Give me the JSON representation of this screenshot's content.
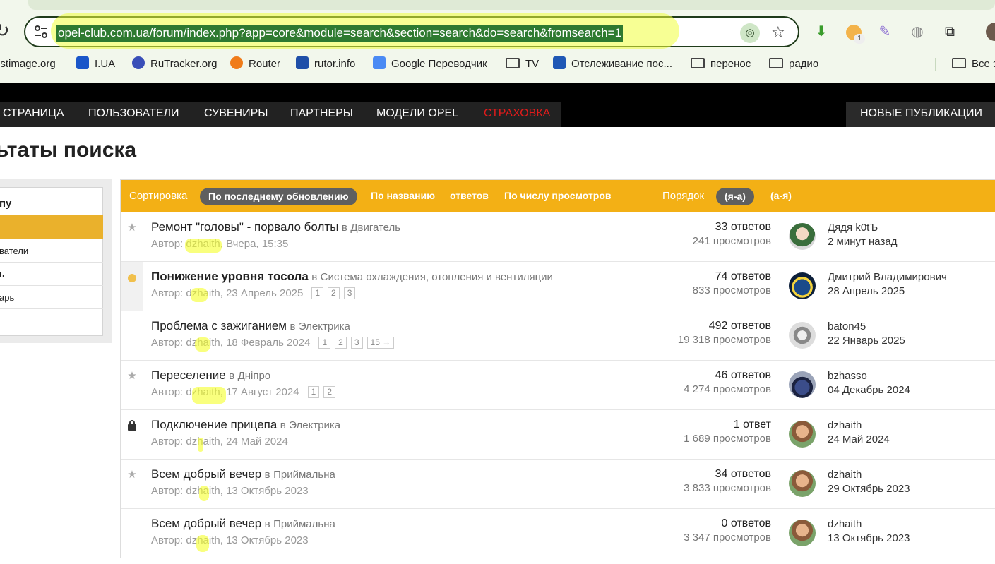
{
  "browser": {
    "url": "opel-club.com.ua/forum/index.php?app=core&module=search&section=search&do=search&fromsearch=1",
    "ext_badge": "1",
    "bookmarks": [
      {
        "label": "ostimage.org",
        "icon": "bookmark-favicon",
        "color": "#2b2b2b"
      },
      {
        "label": "I.UA",
        "icon": "iua-icon",
        "color": "#1a56c9"
      },
      {
        "label": "RuTracker.org",
        "icon": "rutracker-icon",
        "color": "#3a4fb8"
      },
      {
        "label": "Router",
        "icon": "router-icon",
        "color": "#f07c1a"
      },
      {
        "label": "rutor.info",
        "icon": "rutor-icon",
        "color": "#1f4fa8"
      },
      {
        "label": "Google Переводчик",
        "icon": "google-translate-icon",
        "color": "#4a8af4"
      },
      {
        "label": "TV",
        "icon": "folder-icon"
      },
      {
        "label": "Отслеживание пос...",
        "icon": "tracking-24-icon",
        "color": "#1f57b5"
      },
      {
        "label": "перенос",
        "icon": "folder-icon"
      },
      {
        "label": "радио",
        "icon": "folder-icon"
      },
      {
        "label": "Все з",
        "icon": "folder-icon"
      }
    ]
  },
  "nav": {
    "items": [
      "СТРАНИЦА",
      "ПОЛЬЗОВАТЕЛИ",
      "СУВЕНИРЫ",
      "ПАРТНЕРЫ",
      "МОДЕЛИ OPEL",
      "СТРАХОВКА"
    ],
    "right": "НОВЫЕ ПУБЛИКАЦИИ",
    "accent_red": "#e01b1b"
  },
  "page": {
    "title": "ьтаты поиска"
  },
  "sidebar": {
    "heading": "пу",
    "items": [
      "ватели",
      "ь",
      "арь"
    ]
  },
  "sortbar": {
    "sort_label": "Сортировка",
    "active": "По последнему обновлению",
    "by_title": "По названию",
    "by_replies": "ответов",
    "by_views": "По числу просмотров",
    "order_label": "Порядок",
    "order_active": "(я-а)",
    "order_other": "(а-я)",
    "accent": "#f3b015"
  },
  "results": [
    {
      "icon": "star-icon",
      "title": "Ремонт \"головы\" - порвало болты",
      "bold": false,
      "in": "в",
      "forum": "Двигатель",
      "author_prefix": "Автор: ",
      "author": "dzhaith",
      "date": ", Вчера, 15:35",
      "pages": [],
      "replies": "33 ответов",
      "views": "241 просмотров",
      "last_user": "Дядя k0tЪ",
      "last_date": "2 минут назад",
      "unread": false
    },
    {
      "icon": "unread-dot-icon",
      "title": "Понижение уровня тосола",
      "bold": true,
      "in": "в",
      "forum": "Система охлаждения, отопления и вентиляции",
      "author_prefix": "Автор: ",
      "author": "dzhaith",
      "date": ", 23 Апрель 2025",
      "pages": [
        "1",
        "2",
        "3"
      ],
      "replies": "74 ответов",
      "views": "833 просмотров",
      "last_user": "Дмитрий Владимирович",
      "last_date": "28 Апрель 2025",
      "unread": true
    },
    {
      "icon": "none",
      "title": "Проблема с зажиганием",
      "bold": false,
      "in": "в",
      "forum": "Электрика",
      "author_prefix": "Автор: ",
      "author": "dzhaith",
      "date": ", 18 Февраль 2024",
      "pages": [
        "1",
        "2",
        "3",
        "15 →"
      ],
      "replies": "492 ответов",
      "views": "19 318 просмотров",
      "last_user": "baton45",
      "last_date": "22 Январь 2025",
      "unread": false
    },
    {
      "icon": "star-icon",
      "title": "Переселение",
      "bold": false,
      "in": "в",
      "forum": "Дніпро",
      "author_prefix": "Автор: ",
      "author": "dzhaith",
      "date": ", 17 Август 2024",
      "pages": [
        "1",
        "2"
      ],
      "replies": "46 ответов",
      "views": "4 274 просмотров",
      "last_user": "bzhasso",
      "last_date": "04 Декабрь 2024",
      "unread": false
    },
    {
      "icon": "lock-icon",
      "title": "Подключение прицепа",
      "bold": false,
      "in": "в",
      "forum": "Электрика",
      "author_prefix": "Автор: ",
      "author": "dzhaith",
      "date": ", 24 Май 2024",
      "pages": [],
      "replies": "1 ответ",
      "views": "1 689 просмотров",
      "last_user": "dzhaith",
      "last_date": "24 Май 2024",
      "unread": false
    },
    {
      "icon": "star-icon",
      "title": "Всем добрый вечер",
      "bold": false,
      "in": "в",
      "forum": "Приймальна",
      "author_prefix": "Автор: ",
      "author": "dzhaith",
      "date": ", 13 Октябрь 2023",
      "pages": [],
      "replies": "34 ответов",
      "views": "3 833 просмотров",
      "last_user": "dzhaith",
      "last_date": "29 Октябрь 2023",
      "unread": false
    },
    {
      "icon": "none",
      "title": "Всем добрый вечер",
      "bold": false,
      "in": "в",
      "forum": "Приймальна",
      "author_prefix": "Автор: ",
      "author": "dzhaith",
      "date": ", 13 Октябрь 2023",
      "pages": [],
      "replies": "0 ответов",
      "views": "3 347 просмотров",
      "last_user": "dzhaith",
      "last_date": "13 Октябрь 2023",
      "unread": false
    }
  ]
}
